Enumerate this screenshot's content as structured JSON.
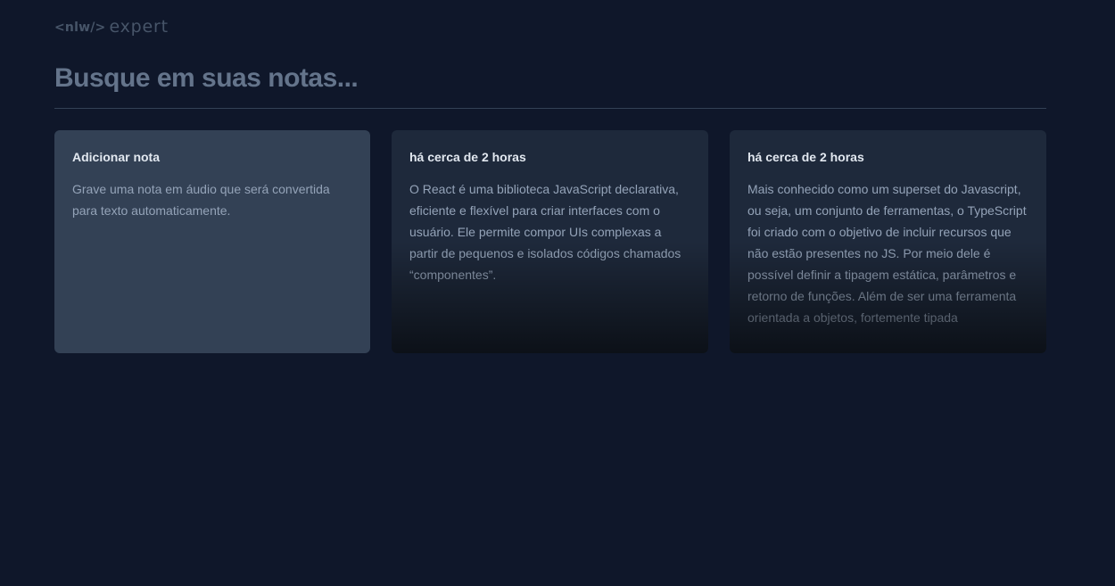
{
  "header": {
    "logo_tag": "<nlw/>",
    "logo_word": "expert"
  },
  "search": {
    "placeholder": "Busque em suas notas..."
  },
  "add_card": {
    "title": "Adicionar nota",
    "description": "Grave uma nota em áudio que será convertida para texto automaticamente."
  },
  "notes": [
    {
      "date": "há cerca de 2 horas",
      "content": "O React é uma biblioteca JavaScript declarativa, eficiente e flexível para criar interfaces com o usuário. Ele permite compor UIs complexas a partir de pequenos e isolados códigos chamados “componentes”."
    },
    {
      "date": "há cerca de 2 horas",
      "content": "Mais conhecido como um superset do Javascript, ou seja, um conjunto de ferramentas, o TypeScript foi criado com o objetivo de incluir recursos que não estão presentes no JS. Por meio dele é possível definir a tipagem estática, parâmetros e retorno de funções. Além de ser uma ferramenta orientada a objetos, fortemente tipada"
    }
  ],
  "colors": {
    "background": "#0f172a",
    "card_add": "#334155",
    "card_note": "#1e293b",
    "muted_text": "#94a3b8",
    "placeholder": "#64748b"
  }
}
